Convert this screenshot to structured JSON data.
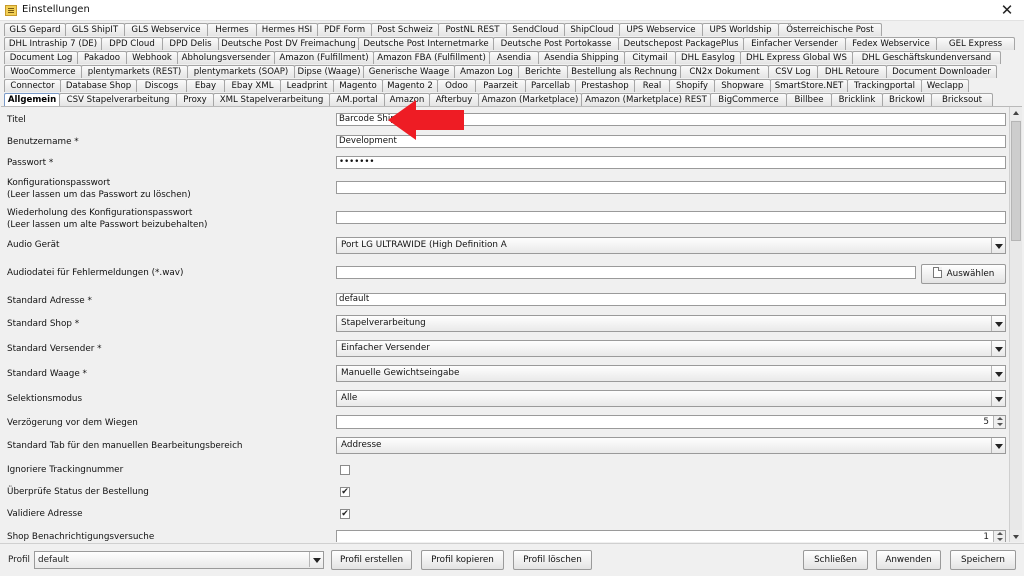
{
  "window": {
    "title": "Einstellungen",
    "close": "✕"
  },
  "tab_rows": [
    {
      "tabs": [
        {
          "label": "GLS Gepard",
          "w": 62
        },
        {
          "label": "GLS ShipIT",
          "w": 60
        },
        {
          "label": "GLS Webservice",
          "w": 84
        },
        {
          "label": "Hermes",
          "w": 50
        },
        {
          "label": "Hermes HSI",
          "w": 62
        },
        {
          "label": "PDF Form",
          "w": 55
        },
        {
          "label": "Post Schweiz",
          "w": 68
        },
        {
          "label": "PostNL REST",
          "w": 69
        },
        {
          "label": "SendCloud",
          "w": 59
        },
        {
          "label": "ShipCloud",
          "w": 56
        },
        {
          "label": "UPS Webservice",
          "w": 84
        },
        {
          "label": "UPS Worldship",
          "w": 77
        },
        {
          "label": "Österreichische Post",
          "w": 104
        }
      ]
    },
    {
      "tabs": [
        {
          "label": "DHL Intraship 7 (DE)",
          "w": 98
        },
        {
          "label": "DPD Cloud",
          "w": 62
        },
        {
          "label": "DPD Delis",
          "w": 57
        },
        {
          "label": "Deutsche Post DV Freimachung",
          "w": 141
        },
        {
          "label": "Deutsche Post Internetmarke",
          "w": 136
        },
        {
          "label": "Deutsche Post Portokasse",
          "w": 126
        },
        {
          "label": "Deutschepost PackagePlus",
          "w": 126
        },
        {
          "label": "Einfacher Versender",
          "w": 103
        },
        {
          "label": "Fedex Webservice",
          "w": 92
        },
        {
          "label": "GEL Express",
          "w": 79
        }
      ]
    },
    {
      "tabs": [
        {
          "label": "Document Log",
          "w": 74
        },
        {
          "label": "Pakadoo",
          "w": 50
        },
        {
          "label": "Webhook",
          "w": 52
        },
        {
          "label": "Abholungsversender",
          "w": 98
        },
        {
          "label": "Amazon (Fulfillment)",
          "w": 100
        },
        {
          "label": "Amazon FBA (Fulfillment)",
          "w": 117
        },
        {
          "label": "Asendia",
          "w": 50
        },
        {
          "label": "Asendia Shipping",
          "w": 87
        },
        {
          "label": "Citymail",
          "w": 52
        },
        {
          "label": "DHL Easylog",
          "w": 66
        },
        {
          "label": "DHL Express Global WS",
          "w": 113
        },
        {
          "label": "DHL Geschäftskundenversand",
          "w": 149
        }
      ]
    },
    {
      "tabs": [
        {
          "label": "WooCommerce",
          "w": 78
        },
        {
          "label": "plentymarkets (REST)",
          "w": 107
        },
        {
          "label": "plentymarkets (SOAP)",
          "w": 108
        },
        {
          "label": "Dipse (Waage)",
          "w": 70
        },
        {
          "label": "Generische Waage",
          "w": 92
        },
        {
          "label": "Amazon Log",
          "w": 65
        },
        {
          "label": "Berichte",
          "w": 50
        },
        {
          "label": "Bestellung als Rechnung",
          "w": 114
        },
        {
          "label": "CN2x Dokument",
          "w": 89
        },
        {
          "label": "CSV Log",
          "w": 50
        },
        {
          "label": "DHL Retoure",
          "w": 70
        },
        {
          "label": "Document Downloader",
          "w": 111
        }
      ]
    },
    {
      "tabs": [
        {
          "label": "Connector",
          "w": 57
        },
        {
          "label": "Database Shop",
          "w": 77
        },
        {
          "label": "Discogs",
          "w": 51
        },
        {
          "label": "Ebay",
          "w": 39
        },
        {
          "label": "Ebay XML",
          "w": 57
        },
        {
          "label": "Leadprint",
          "w": 54
        },
        {
          "label": "Magento",
          "w": 50
        },
        {
          "label": "Magento 2",
          "w": 56
        },
        {
          "label": "Odoo",
          "w": 39
        },
        {
          "label": "Paarzeit",
          "w": 51
        },
        {
          "label": "Parcellab",
          "w": 51
        },
        {
          "label": "Prestashop",
          "w": 60
        },
        {
          "label": "Real",
          "w": 36
        },
        {
          "label": "Shopify",
          "w": 46
        },
        {
          "label": "Shopware",
          "w": 57
        },
        {
          "label": "SmartStore.NET",
          "w": 78
        },
        {
          "label": "Trackingportal",
          "w": 75
        },
        {
          "label": "Weclapp",
          "w": 48
        }
      ]
    },
    {
      "tabs": [
        {
          "label": "Allgemein",
          "w": 56,
          "active": true
        },
        {
          "label": "CSV Stapelverarbeitung",
          "w": 118
        },
        {
          "label": "Proxy",
          "w": 38
        },
        {
          "label": "XML Stapelverarbeitung",
          "w": 117
        },
        {
          "label": "AM.portal",
          "w": 56
        },
        {
          "label": "Amazon",
          "w": 46
        },
        {
          "label": "Afterbuy",
          "w": 50
        },
        {
          "label": "Amazon (Marketplace)",
          "w": 104
        },
        {
          "label": "Amazon (Marketplace) REST",
          "w": 130
        },
        {
          "label": "BigCommerce",
          "w": 77
        },
        {
          "label": "Billbee",
          "w": 46
        },
        {
          "label": "Bricklink",
          "w": 52
        },
        {
          "label": "Brickowl",
          "w": 50
        },
        {
          "label": "Bricksout",
          "w": 62
        }
      ]
    }
  ],
  "form": {
    "titel": {
      "label": "Titel",
      "value": "Barcode Shipp"
    },
    "benutzername": {
      "label": "Benutzername *",
      "value": "Development"
    },
    "passwort": {
      "label": "Passwort *",
      "value": "•••••••"
    },
    "konfig_pw": {
      "label_1": "Konfigurationspasswort",
      "label_2": "(Leer lassen um das Passwort zu löschen)",
      "value": ""
    },
    "konfig_pw_repeat": {
      "label_1": "Wiederholung des Konfigurationspasswort",
      "label_2": "(Leer lassen um alte Passwort beizubehalten)",
      "value": ""
    },
    "audio_geraet": {
      "label": "Audio Gerät",
      "value": "Port LG ULTRAWIDE (High Definition A"
    },
    "audiodatei": {
      "label": "Audiodatei für Fehlermeldungen (*.wav)",
      "value": "",
      "button": "Auswählen"
    },
    "standard_adresse": {
      "label": "Standard Adresse *",
      "value": "default"
    },
    "standard_shop": {
      "label": "Standard Shop *",
      "value": "Stapelverarbeitung"
    },
    "standard_versender": {
      "label": "Standard Versender *",
      "value": "Einfacher Versender"
    },
    "standard_waage": {
      "label": "Standard Waage *",
      "value": "Manuelle Gewichtseingabe"
    },
    "selektionsmodus": {
      "label": "Selektionsmodus",
      "value": "Alle"
    },
    "verzoegerung": {
      "label": "Verzögerung vor dem Wiegen",
      "value": "5"
    },
    "standard_tab": {
      "label": "Standard Tab für den manuellen Bearbeitungsbereich",
      "value": "Addresse"
    },
    "ignoriere_tracking": {
      "label": "Ignoriere Trackingnummer",
      "checked": false,
      "mark": ""
    },
    "pruefe_status": {
      "label": "Überprüfe Status der Bestellung",
      "checked": true,
      "mark": "✔"
    },
    "validiere_adresse": {
      "label": "Validiere Adresse",
      "checked": true,
      "mark": "✔"
    },
    "shop_benachrichtigung": {
      "label": "Shop Benachrichtigungsversuche",
      "value": "1"
    }
  },
  "footer": {
    "profil_label": "Profil",
    "profil_value": "default",
    "buttons": {
      "erstellen": "Profil erstellen",
      "kopieren": "Profil kopieren",
      "loeschen": "Profil löschen",
      "schliessen": "Schließen",
      "anwenden": "Anwenden",
      "speichern": "Speichern"
    }
  },
  "colors": {
    "annotation_arrow": "#ee1c24",
    "active_tab_border": "#7a9ac8"
  }
}
